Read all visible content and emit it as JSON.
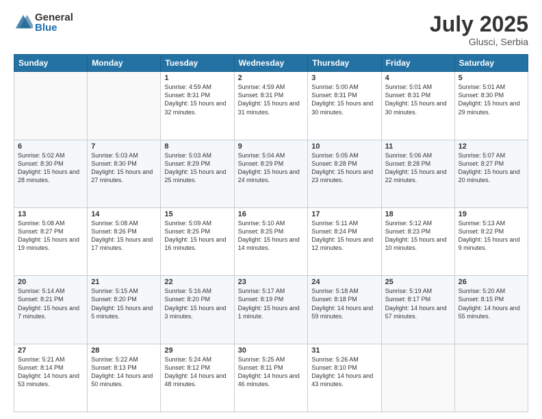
{
  "logo": {
    "general": "General",
    "blue": "Blue"
  },
  "title": {
    "month_year": "July 2025",
    "location": "Glusci, Serbia"
  },
  "weekdays": [
    "Sunday",
    "Monday",
    "Tuesday",
    "Wednesday",
    "Thursday",
    "Friday",
    "Saturday"
  ],
  "weeks": [
    [
      {
        "day": "",
        "sunrise": "",
        "sunset": "",
        "daylight": ""
      },
      {
        "day": "",
        "sunrise": "",
        "sunset": "",
        "daylight": ""
      },
      {
        "day": "1",
        "sunrise": "Sunrise: 4:59 AM",
        "sunset": "Sunset: 8:31 PM",
        "daylight": "Daylight: 15 hours and 32 minutes."
      },
      {
        "day": "2",
        "sunrise": "Sunrise: 4:59 AM",
        "sunset": "Sunset: 8:31 PM",
        "daylight": "Daylight: 15 hours and 31 minutes."
      },
      {
        "day": "3",
        "sunrise": "Sunrise: 5:00 AM",
        "sunset": "Sunset: 8:31 PM",
        "daylight": "Daylight: 15 hours and 30 minutes."
      },
      {
        "day": "4",
        "sunrise": "Sunrise: 5:01 AM",
        "sunset": "Sunset: 8:31 PM",
        "daylight": "Daylight: 15 hours and 30 minutes."
      },
      {
        "day": "5",
        "sunrise": "Sunrise: 5:01 AM",
        "sunset": "Sunset: 8:30 PM",
        "daylight": "Daylight: 15 hours and 29 minutes."
      }
    ],
    [
      {
        "day": "6",
        "sunrise": "Sunrise: 5:02 AM",
        "sunset": "Sunset: 8:30 PM",
        "daylight": "Daylight: 15 hours and 28 minutes."
      },
      {
        "day": "7",
        "sunrise": "Sunrise: 5:03 AM",
        "sunset": "Sunset: 8:30 PM",
        "daylight": "Daylight: 15 hours and 27 minutes."
      },
      {
        "day": "8",
        "sunrise": "Sunrise: 5:03 AM",
        "sunset": "Sunset: 8:29 PM",
        "daylight": "Daylight: 15 hours and 25 minutes."
      },
      {
        "day": "9",
        "sunrise": "Sunrise: 5:04 AM",
        "sunset": "Sunset: 8:29 PM",
        "daylight": "Daylight: 15 hours and 24 minutes."
      },
      {
        "day": "10",
        "sunrise": "Sunrise: 5:05 AM",
        "sunset": "Sunset: 8:28 PM",
        "daylight": "Daylight: 15 hours and 23 minutes."
      },
      {
        "day": "11",
        "sunrise": "Sunrise: 5:06 AM",
        "sunset": "Sunset: 8:28 PM",
        "daylight": "Daylight: 15 hours and 22 minutes."
      },
      {
        "day": "12",
        "sunrise": "Sunrise: 5:07 AM",
        "sunset": "Sunset: 8:27 PM",
        "daylight": "Daylight: 15 hours and 20 minutes."
      }
    ],
    [
      {
        "day": "13",
        "sunrise": "Sunrise: 5:08 AM",
        "sunset": "Sunset: 8:27 PM",
        "daylight": "Daylight: 15 hours and 19 minutes."
      },
      {
        "day": "14",
        "sunrise": "Sunrise: 5:08 AM",
        "sunset": "Sunset: 8:26 PM",
        "daylight": "Daylight: 15 hours and 17 minutes."
      },
      {
        "day": "15",
        "sunrise": "Sunrise: 5:09 AM",
        "sunset": "Sunset: 8:25 PM",
        "daylight": "Daylight: 15 hours and 16 minutes."
      },
      {
        "day": "16",
        "sunrise": "Sunrise: 5:10 AM",
        "sunset": "Sunset: 8:25 PM",
        "daylight": "Daylight: 15 hours and 14 minutes."
      },
      {
        "day": "17",
        "sunrise": "Sunrise: 5:11 AM",
        "sunset": "Sunset: 8:24 PM",
        "daylight": "Daylight: 15 hours and 12 minutes."
      },
      {
        "day": "18",
        "sunrise": "Sunrise: 5:12 AM",
        "sunset": "Sunset: 8:23 PM",
        "daylight": "Daylight: 15 hours and 10 minutes."
      },
      {
        "day": "19",
        "sunrise": "Sunrise: 5:13 AM",
        "sunset": "Sunset: 8:22 PM",
        "daylight": "Daylight: 15 hours and 9 minutes."
      }
    ],
    [
      {
        "day": "20",
        "sunrise": "Sunrise: 5:14 AM",
        "sunset": "Sunset: 8:21 PM",
        "daylight": "Daylight: 15 hours and 7 minutes."
      },
      {
        "day": "21",
        "sunrise": "Sunrise: 5:15 AM",
        "sunset": "Sunset: 8:20 PM",
        "daylight": "Daylight: 15 hours and 5 minutes."
      },
      {
        "day": "22",
        "sunrise": "Sunrise: 5:16 AM",
        "sunset": "Sunset: 8:20 PM",
        "daylight": "Daylight: 15 hours and 3 minutes."
      },
      {
        "day": "23",
        "sunrise": "Sunrise: 5:17 AM",
        "sunset": "Sunset: 8:19 PM",
        "daylight": "Daylight: 15 hours and 1 minute."
      },
      {
        "day": "24",
        "sunrise": "Sunrise: 5:18 AM",
        "sunset": "Sunset: 8:18 PM",
        "daylight": "Daylight: 14 hours and 59 minutes."
      },
      {
        "day": "25",
        "sunrise": "Sunrise: 5:19 AM",
        "sunset": "Sunset: 8:17 PM",
        "daylight": "Daylight: 14 hours and 57 minutes."
      },
      {
        "day": "26",
        "sunrise": "Sunrise: 5:20 AM",
        "sunset": "Sunset: 8:15 PM",
        "daylight": "Daylight: 14 hours and 55 minutes."
      }
    ],
    [
      {
        "day": "27",
        "sunrise": "Sunrise: 5:21 AM",
        "sunset": "Sunset: 8:14 PM",
        "daylight": "Daylight: 14 hours and 53 minutes."
      },
      {
        "day": "28",
        "sunrise": "Sunrise: 5:22 AM",
        "sunset": "Sunset: 8:13 PM",
        "daylight": "Daylight: 14 hours and 50 minutes."
      },
      {
        "day": "29",
        "sunrise": "Sunrise: 5:24 AM",
        "sunset": "Sunset: 8:12 PM",
        "daylight": "Daylight: 14 hours and 48 minutes."
      },
      {
        "day": "30",
        "sunrise": "Sunrise: 5:25 AM",
        "sunset": "Sunset: 8:11 PM",
        "daylight": "Daylight: 14 hours and 46 minutes."
      },
      {
        "day": "31",
        "sunrise": "Sunrise: 5:26 AM",
        "sunset": "Sunset: 8:10 PM",
        "daylight": "Daylight: 14 hours and 43 minutes."
      },
      {
        "day": "",
        "sunrise": "",
        "sunset": "",
        "daylight": ""
      },
      {
        "day": "",
        "sunrise": "",
        "sunset": "",
        "daylight": ""
      }
    ]
  ]
}
